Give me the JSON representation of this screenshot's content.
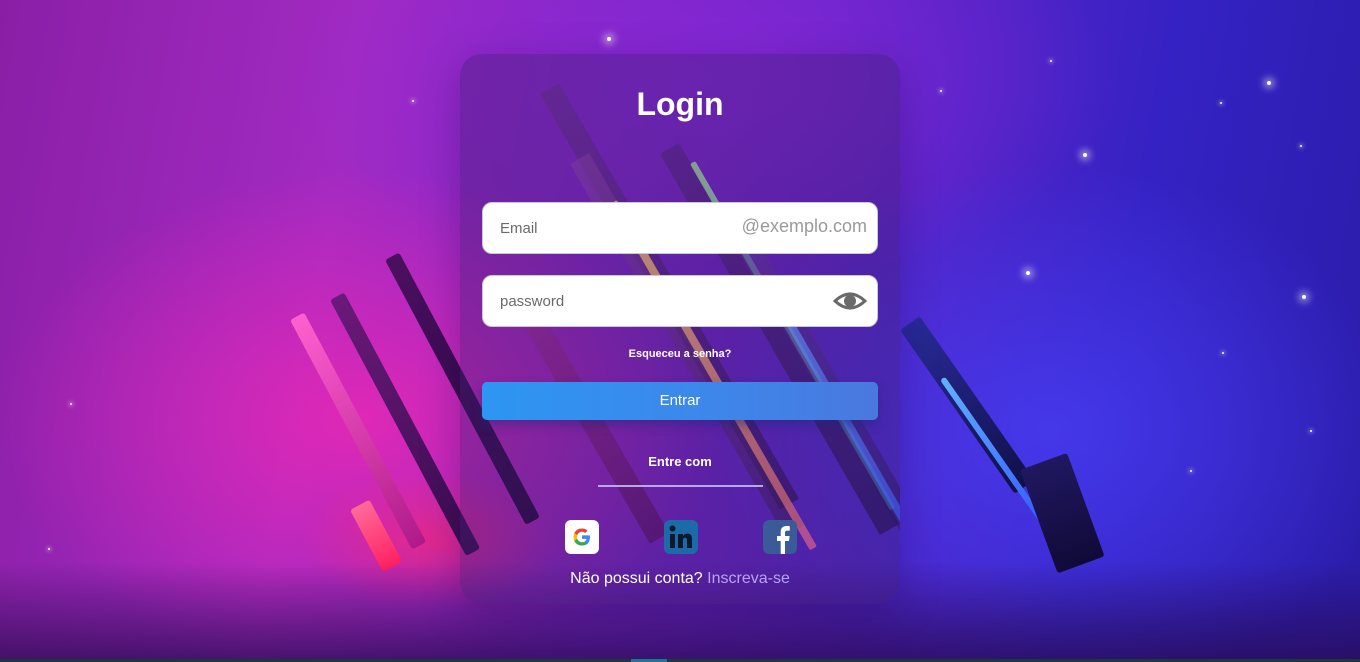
{
  "login": {
    "title": "Login",
    "email_placeholder": "Email",
    "email_suffix": "@exemplo.com",
    "password_placeholder": "password",
    "forgot_password": "Esqueceu a senha?",
    "submit_label": "Entrar",
    "social_heading": "Entre com",
    "social": [
      {
        "name": "google-icon"
      },
      {
        "name": "linkedin-icon"
      },
      {
        "name": "facebook-icon"
      }
    ],
    "signup_prompt": "Não possui conta?",
    "signup_link": "Inscreva-se"
  },
  "colors": {
    "accent": "#2d96f2",
    "link": "#b8a4f5"
  }
}
